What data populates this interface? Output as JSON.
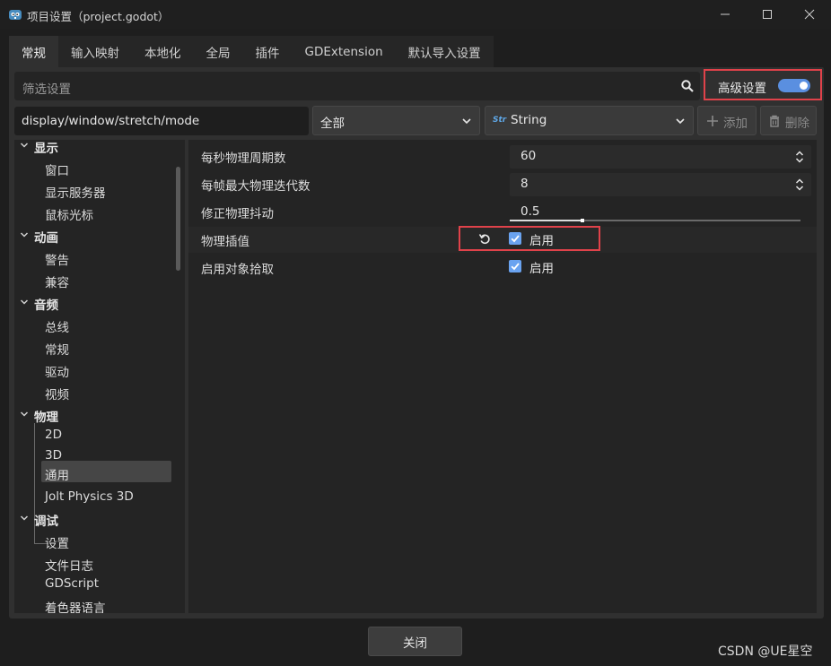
{
  "window": {
    "title": "项目设置（project.godot）",
    "controls": {
      "minimize": "minimize-icon",
      "maximize": "maximize-icon",
      "close": "close-icon"
    }
  },
  "tabs": [
    {
      "label": "常规",
      "active": true
    },
    {
      "label": "输入映射",
      "active": false
    },
    {
      "label": "本地化",
      "active": false
    },
    {
      "label": "全局",
      "active": false
    },
    {
      "label": "插件",
      "active": false
    },
    {
      "label": "GDExtension",
      "active": false
    },
    {
      "label": "默认导入设置",
      "active": false
    }
  ],
  "filter": {
    "placeholder": "筛选设置"
  },
  "advanced": {
    "label": "高级设置",
    "enabled": true
  },
  "property_path": "display/window/stretch/mode",
  "category_select": {
    "value": "全部"
  },
  "type_select": {
    "value": "String",
    "icon_text": "Str"
  },
  "actions": {
    "add_label": "添加",
    "delete_label": "删除"
  },
  "tree": [
    {
      "label": "显示",
      "type": "category"
    },
    {
      "label": "窗口",
      "type": "item"
    },
    {
      "label": "显示服务器",
      "type": "item"
    },
    {
      "label": "鼠标光标",
      "type": "item"
    },
    {
      "label": "动画",
      "type": "category"
    },
    {
      "label": "警告",
      "type": "item"
    },
    {
      "label": "兼容",
      "type": "item"
    },
    {
      "label": "音频",
      "type": "category"
    },
    {
      "label": "总线",
      "type": "item"
    },
    {
      "label": "常规",
      "type": "item"
    },
    {
      "label": "驱动",
      "type": "item"
    },
    {
      "label": "视频",
      "type": "item"
    },
    {
      "label": "物理",
      "type": "category"
    },
    {
      "label": "2D",
      "type": "item"
    },
    {
      "label": "3D",
      "type": "item"
    },
    {
      "label": "通用",
      "type": "item",
      "selected": true
    },
    {
      "label": "Jolt Physics 3D",
      "type": "item"
    },
    {
      "label": "调试",
      "type": "category"
    },
    {
      "label": "设置",
      "type": "item"
    },
    {
      "label": "文件日志",
      "type": "item"
    },
    {
      "label": "GDScript",
      "type": "item"
    },
    {
      "label": "着色器语言",
      "type": "item"
    }
  ],
  "properties": [
    {
      "name": "每秒物理周期数",
      "value": "60"
    },
    {
      "name": "每帧最大物理迭代数",
      "value": "8"
    },
    {
      "name": "修正物理抖动",
      "value": "0.5",
      "slider_fraction": 0.25
    },
    {
      "name": "物理插值",
      "checkbox_label": "启用",
      "checked": true
    },
    {
      "name": "启用对象拾取",
      "checkbox_label": "启用",
      "checked": true
    }
  ],
  "close_button": "关闭",
  "watermark": "CSDN @UE星空",
  "colors": {
    "accent": "#5a8fe0",
    "highlight": "#e0424a",
    "panel": "#303030"
  }
}
